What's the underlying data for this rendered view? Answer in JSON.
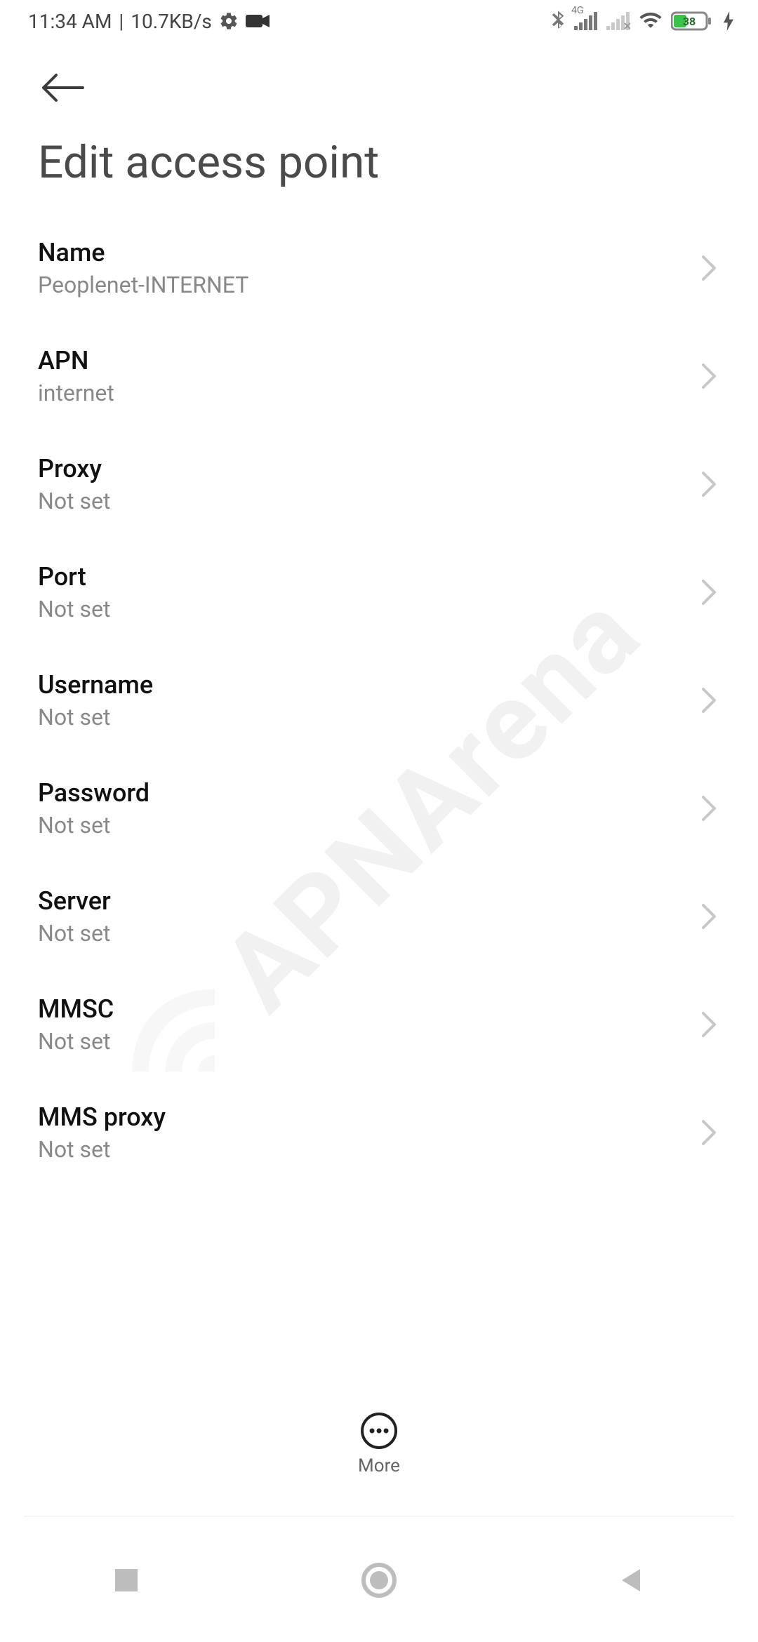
{
  "status": {
    "time": "11:34 AM",
    "sep": "|",
    "net_speed": "10.7KB/s",
    "icons": {
      "settings": "settings-icon",
      "camera": "camera-icon",
      "bluetooth": "bluetooth-icon",
      "sim1_label": "4G",
      "wifi": "wifi-icon"
    },
    "battery": {
      "percent": "38"
    }
  },
  "header": {
    "title": "Edit access point"
  },
  "settings": {
    "name": {
      "title": "Name",
      "value": "Peoplenet-INTERNET"
    },
    "apn": {
      "title": "APN",
      "value": "internet"
    },
    "proxy": {
      "title": "Proxy",
      "value": "Not set"
    },
    "port": {
      "title": "Port",
      "value": "Not set"
    },
    "username": {
      "title": "Username",
      "value": "Not set"
    },
    "password": {
      "title": "Password",
      "value": "Not set"
    },
    "server": {
      "title": "Server",
      "value": "Not set"
    },
    "mmsc": {
      "title": "MMSC",
      "value": "Not set"
    },
    "mms_proxy": {
      "title": "MMS proxy",
      "value": "Not set"
    }
  },
  "fab": {
    "more_label": "More"
  },
  "watermark": {
    "text": "APNArena"
  }
}
